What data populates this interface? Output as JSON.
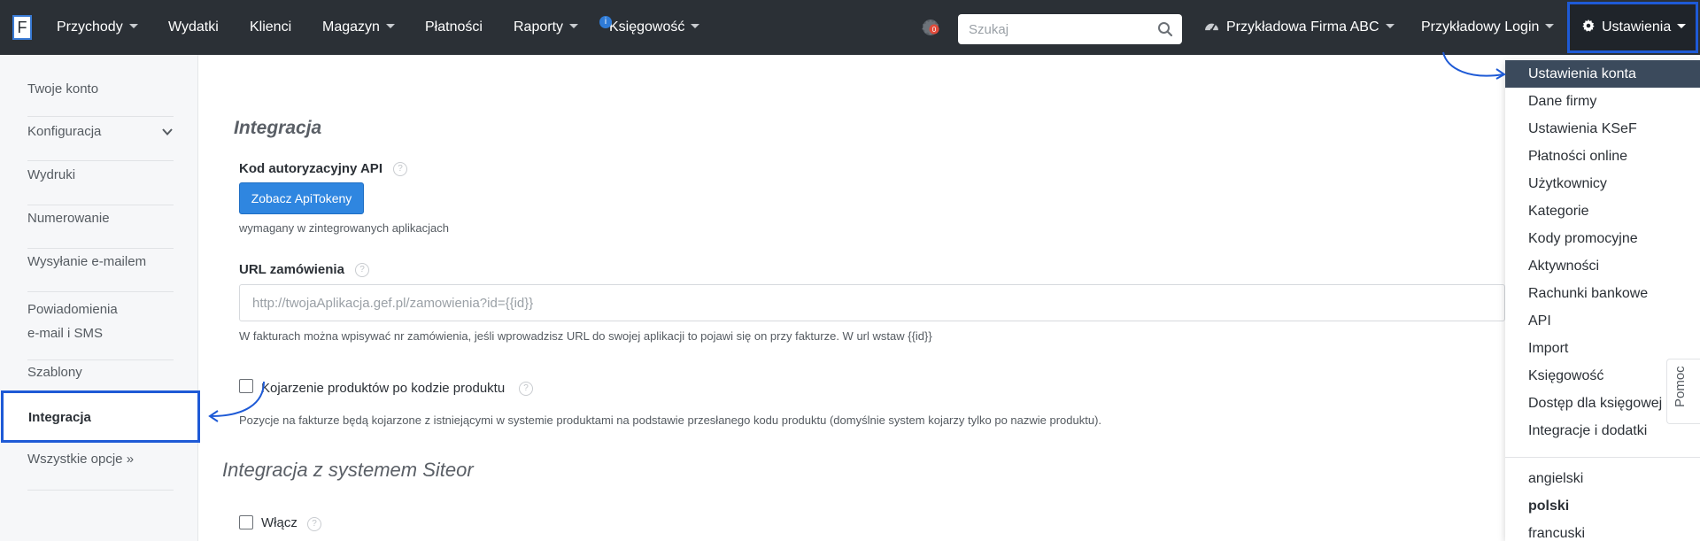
{
  "nav": {
    "logo": "F",
    "items": [
      {
        "label": "Przychody",
        "dropdown": true
      },
      {
        "label": "Wydatki",
        "dropdown": false
      },
      {
        "label": "Klienci",
        "dropdown": false
      },
      {
        "label": "Magazyn",
        "dropdown": true
      },
      {
        "label": "Płatności",
        "dropdown": false
      },
      {
        "label": "Raporty",
        "dropdown": true
      },
      {
        "label": "Księgowość",
        "dropdown": true
      }
    ],
    "ksiegowosc_badge": "i",
    "notification_badge": "0",
    "search_placeholder": "Szukaj",
    "company": "Przykładowa Firma ABC",
    "login": "Przykładowy Login",
    "settings": "Ustawienia"
  },
  "sidebar": {
    "items": [
      "Twoje konto",
      "Konfiguracja",
      "Wydruki",
      "Numerowanie",
      "Wysyłanie e-mailem",
      "Powiadomienia",
      "e-mail i SMS",
      "Szablony",
      "Integracja",
      "Wszystkie opcje »"
    ]
  },
  "main": {
    "section_title": "Integracja",
    "api": {
      "label": "Kod autoryzacyjny API",
      "button": "Zobacz ApiTokeny",
      "helper": "wymagany w zintegrowanych aplikacjach"
    },
    "url": {
      "label": "URL zamówienia",
      "placeholder": "http://twojaAplikacja.gef.pl/zamowienia?id={{id}}",
      "helper": "W fakturach można wpisywać nr zamówienia, jeśli wprowadzisz URL do swojej aplikacji to pojawi się on przy fakturze. W url wstaw {{id}}"
    },
    "products": {
      "label": "Kojarzenie produktów po kodzie produktu",
      "checked": false,
      "helper": "Pozycje na fakturze będą kojarzone z istniejącymi w systemie produktami na podstawie przesłanego kodu produktu (domyślnie system kojarzy tylko po nazwie produktu)."
    },
    "siteor_title": "Integracja z systemem Siteor",
    "siteor_enable": {
      "label": "Włącz",
      "checked": false
    },
    "help_glyph": "?"
  },
  "dropdown": {
    "items": [
      "Ustawienia konta",
      "Dane firmy",
      "Ustawienia KSeF",
      "Płatności online",
      "Użytkownicy",
      "Kategorie",
      "Kody promocyjne",
      "Aktywności",
      "Rachunki bankowe",
      "API",
      "Import",
      "Księgowość",
      "Dostęp dla księgowej",
      "Integracje i dodatki"
    ],
    "languages": [
      "angielski",
      "polski",
      "francuski"
    ],
    "active_item": "Ustawienia konta",
    "active_language": "polski"
  },
  "pomoc": "Pomoc",
  "colors": {
    "navbar": "#2b3036",
    "accent": "#1e5ad6",
    "button": "#2f86e0",
    "dropdown_active": "#3b4a5c"
  }
}
